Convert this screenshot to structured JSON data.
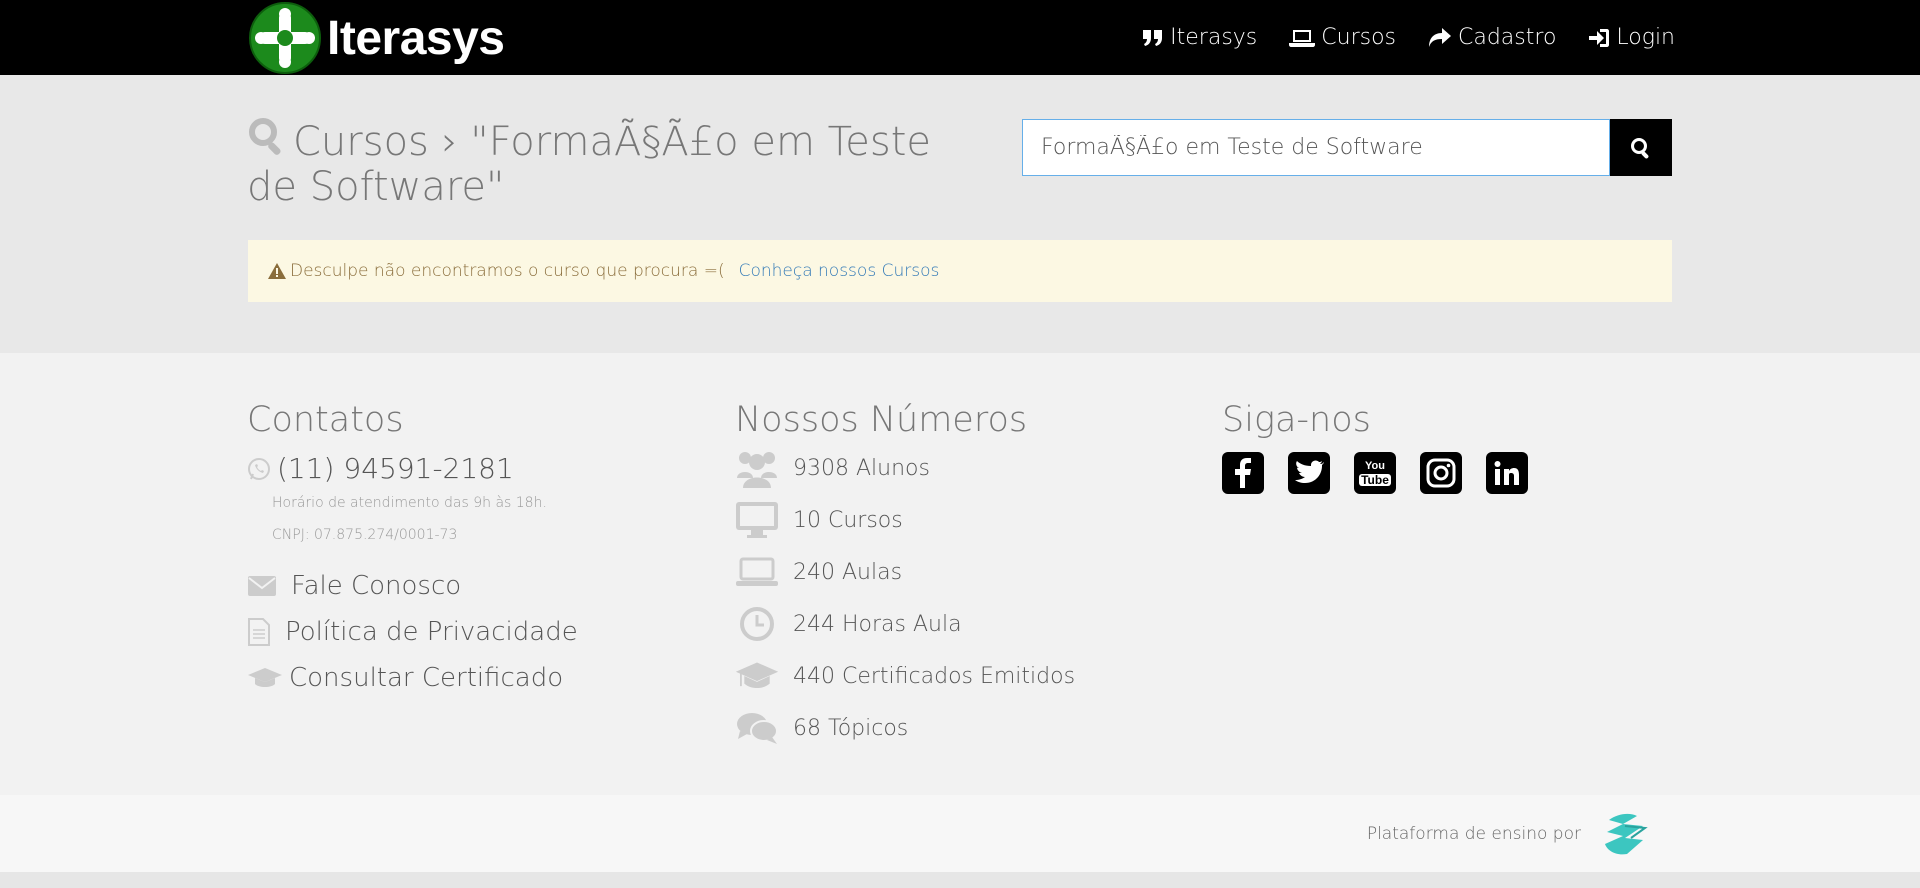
{
  "brand": {
    "name": "Iterasys"
  },
  "nav": {
    "items": [
      {
        "label": "Iterasys",
        "icon": "quote-icon"
      },
      {
        "label": "Cursos",
        "icon": "laptop-icon"
      },
      {
        "label": "Cadastro",
        "icon": "share-icon"
      },
      {
        "label": "Login",
        "icon": "sign-in-icon"
      }
    ]
  },
  "search": {
    "title": "Cursos › \"FormaÃ§Ã£o em Teste de Software\"",
    "value": "FormaÃ§Ã£o em Teste de Software"
  },
  "alert": {
    "message": "Desculpe não encontramos o curso que procura =(",
    "link": "Conheça nossos Cursos"
  },
  "contacts": {
    "heading": "Contatos",
    "phone": "(11) 94591-2181",
    "hours": "Horário de atendimento das 9h às 18h.",
    "cnpj": "CNPJ: 07.875.274/0001-73",
    "links": [
      "Fale Conosco",
      "Política de Privacidade",
      "Consultar Certificado"
    ]
  },
  "numbers": {
    "heading": "Nossos Números",
    "items": [
      "9308 Alunos",
      "10 Cursos",
      "240 Aulas",
      "244 Horas Aula",
      "440 Certificados Emitidos",
      "68 Tópicos"
    ]
  },
  "social": {
    "heading": "Siga-nos",
    "networks": [
      "facebook-icon",
      "twitter-icon",
      "youtube-icon",
      "instagram-icon",
      "linkedin-icon"
    ]
  },
  "footer": {
    "platform": "Plataforma de ensino por"
  },
  "colors": {
    "accent_green": "#1c8a1c",
    "link_blue": "#337ab7",
    "alert_bg": "#fcf8e3",
    "logo_teal": "#3cc6c0"
  }
}
